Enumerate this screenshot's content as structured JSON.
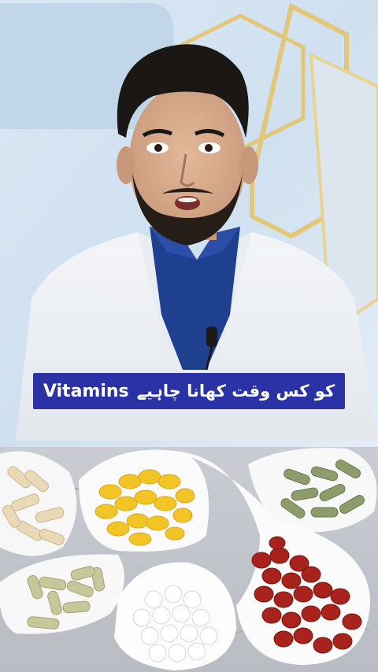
{
  "caption": {
    "urdu_text": "کو کس وقت کھانا چاہیے",
    "english_word": "Vitamins",
    "background_color": "#2a32a6",
    "text_color": "#ffffff"
  },
  "scene": {
    "presenter": "man in white lab coat with lapel microphone",
    "background": "light blue wall with gold hexagon outlines",
    "supplements": [
      "herbal capsules",
      "yellow softgels",
      "green capsules",
      "white capsules",
      "white tablets",
      "red softgels"
    ]
  }
}
